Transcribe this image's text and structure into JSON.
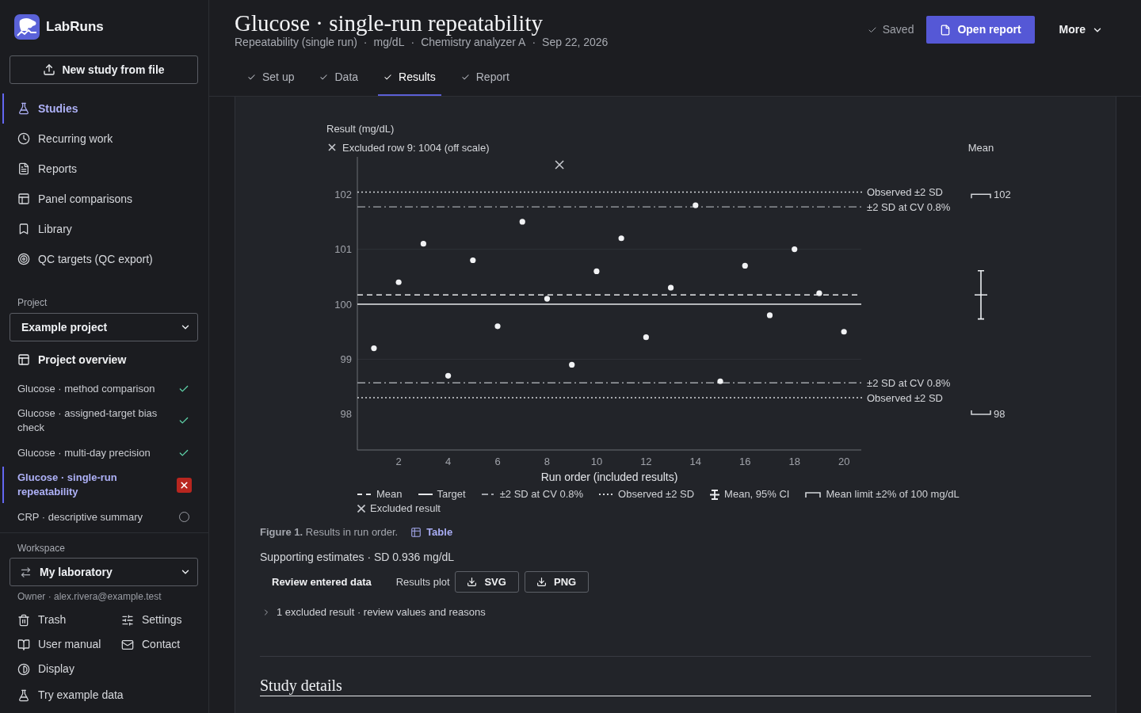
{
  "sidebar": {
    "brand": "LabRuns",
    "new_study_button": "New study from file",
    "nav": [
      {
        "label": "Studies",
        "selected": true
      },
      {
        "label": "Recurring work",
        "selected": false
      },
      {
        "label": "Reports",
        "selected": false
      },
      {
        "label": "Panel comparisons",
        "selected": false
      },
      {
        "label": "Library",
        "selected": false
      },
      {
        "label": "QC targets (QC export)",
        "selected": false
      }
    ],
    "project": {
      "label": "Project",
      "value": "Example project"
    },
    "project_overview": "Project overview",
    "studies": [
      {
        "label": "Glucose · method comparison",
        "kind": "done",
        "selected": false
      },
      {
        "label": "Glucose · assigned-target bias check",
        "kind": "done",
        "selected": false
      },
      {
        "label": "Glucose · multi-day precision",
        "kind": "done",
        "selected": false
      },
      {
        "label": "Glucose · single-run repeatability",
        "kind": "error",
        "selected": true
      },
      {
        "label": "CRP · descriptive summary",
        "kind": "pending",
        "selected": false
      }
    ],
    "workspace": {
      "label": "Workspace",
      "value": "My laboratory",
      "owner": "Owner · alex.rivera@example.test"
    },
    "link_rows": [
      [
        "Trash",
        "Settings"
      ],
      [
        "User manual",
        "Contact"
      ],
      [
        "Display"
      ],
      [
        "Try example data"
      ]
    ]
  },
  "header": {
    "title": "Glucose · single-run repeatability",
    "meta": [
      "Repeatability (single run)",
      "mg/dL",
      "Chemistry analyzer A",
      "Sep 22, 2026"
    ],
    "meta_separator": "·",
    "save_status": "Saved",
    "primary_button": "Open report",
    "menu_button": "More"
  },
  "tabs": [
    {
      "label": "Set up",
      "done": true,
      "selected": false
    },
    {
      "label": "Data",
      "done": true,
      "selected": false
    },
    {
      "label": "Results",
      "done": true,
      "selected": true
    },
    {
      "label": "Report",
      "done": true,
      "selected": false
    }
  ],
  "results": {
    "chart": {
      "side_title": "Mean",
      "chart_data": {
        "type": "scatter",
        "ylabel": "Result (mg/dL)",
        "xlabel": "Run order (included results)",
        "x": [
          1,
          2,
          3,
          4,
          5,
          6,
          7,
          8,
          9,
          10,
          11,
          12,
          13,
          14,
          15,
          16,
          17,
          18,
          19,
          20
        ],
        "series": [
          {
            "color": "#f1f2f4",
            "values": [
              99.2,
              100.4,
              101.1,
              98.7,
              100.8,
              99.6,
              101.5,
              100.1,
              98.9,
              100.6,
              101.2,
              99.4,
              100.3,
              101.8,
              98.6,
              100.7,
              99.8,
              101.0,
              100.2,
              99.5
            ]
          }
        ],
        "xlim": [
          0.33,
          20.7
        ],
        "ylim": [
          97.35,
          102.68
        ],
        "xticks": [
          2,
          4,
          6,
          8,
          10,
          12,
          14,
          16,
          18,
          20
        ],
        "yticks": [
          98,
          99,
          100,
          101,
          102
        ],
        "grid": true,
        "ref_lines": [
          {
            "axis": "y",
            "value": 102.04,
            "label": "Observed ±2 SD"
          },
          {
            "axis": "y",
            "value": 101.77,
            "label": "±2 SD at CV 0.8%"
          },
          {
            "axis": "y",
            "value": 100.17
          },
          {
            "axis": "y",
            "value": 100
          },
          {
            "axis": "y",
            "value": 98.57,
            "label": "±2 SD at CV 0.8%"
          },
          {
            "axis": "y",
            "value": 98.3,
            "label": "Observed ±2 SD"
          },
          {
            "axis": "y",
            "value": 102,
            "label": "102"
          },
          {
            "axis": "y",
            "value": 98,
            "label": "98"
          }
        ],
        "annotations": [
          {
            "text": "Excluded row 9: 1004 (off scale)"
          }
        ]
      },
      "legend": [
        {
          "kind": "dashed",
          "label": "Mean"
        },
        {
          "kind": "solid",
          "label": "Target"
        },
        {
          "kind": "dashdot",
          "label": "±2 SD at CV 0.8%"
        },
        {
          "kind": "dotted",
          "label": "Observed ±2 SD"
        },
        {
          "kind": "errorbar",
          "label": "Mean, 95% CI"
        },
        {
          "kind": "bracket",
          "label": "Mean limit ±2% of 100 mg/dL"
        },
        {
          "kind": "cross",
          "label": "Excluded result"
        }
      ]
    },
    "caption": "**Figure 1.** Results in run order.",
    "table_link": "Table",
    "supporting_estimates": "Supporting estimates · SD 0.936 mg/dL",
    "review_button": "Review entered data",
    "export_label": "Results plot",
    "export_buttons": [
      "SVG",
      "PNG"
    ],
    "excluded_disclosure": {
      "label": "1 excluded result · review values and reasons",
      "expanded": false
    }
  },
  "study_details": {
    "title": "Study details"
  }
}
